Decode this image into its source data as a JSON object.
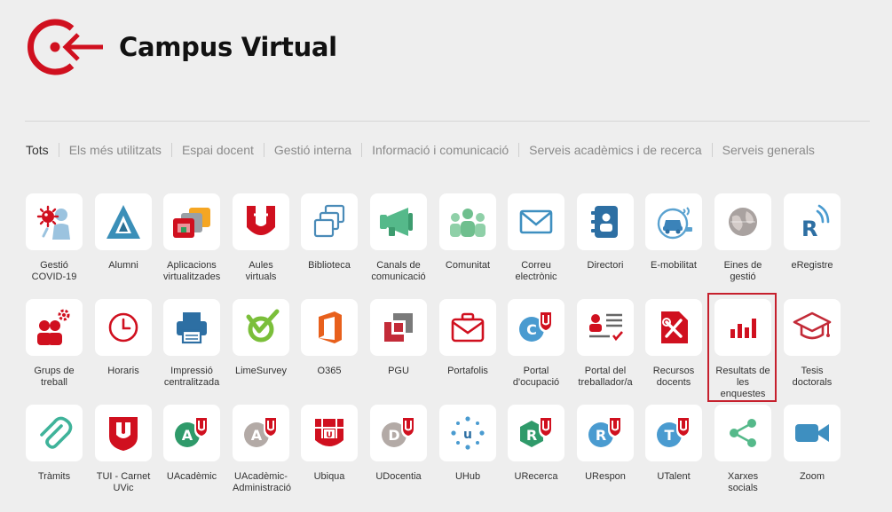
{
  "header": {
    "title": "Campus Virtual",
    "logo_icon": "campus-logo-arrow-icon",
    "brand_color": "#d0101f"
  },
  "filters": [
    {
      "label": "Tots",
      "active": true
    },
    {
      "label": "Els més utilitzats",
      "active": false
    },
    {
      "label": "Espai docent",
      "active": false
    },
    {
      "label": "Gestió interna",
      "active": false
    },
    {
      "label": "Informació i comunicació",
      "active": false
    },
    {
      "label": "Serveis acadèmics i de recerca",
      "active": false
    },
    {
      "label": "Serveis generals",
      "active": false
    }
  ],
  "apps": [
    {
      "id": "gestio-covid-19",
      "label": "Gestió COVID-19",
      "icon": "virus-person-icon"
    },
    {
      "id": "alumni",
      "label": "Alumni",
      "icon": "alumni-a-icon"
    },
    {
      "id": "aplicacions-virtualitzades",
      "label": "Aplicacions virtualitzades",
      "icon": "stacked-folders-icon"
    },
    {
      "id": "aules-virtuals",
      "label": "Aules virtuals",
      "icon": "uvic-u-icon"
    },
    {
      "id": "biblioteca",
      "label": "Biblioteca",
      "icon": "windows-stack-icon"
    },
    {
      "id": "canals-de-comunicacio",
      "label": "Canals de comunicació",
      "icon": "megaphone-icon"
    },
    {
      "id": "comunitat",
      "label": "Comunitat",
      "icon": "people-group-icon"
    },
    {
      "id": "correu-electronic",
      "label": "Correu electrònic",
      "icon": "envelope-icon"
    },
    {
      "id": "directori",
      "label": "Directori",
      "icon": "address-book-icon"
    },
    {
      "id": "e-mobilitat",
      "label": "E-mobilitat",
      "icon": "electric-car-icon"
    },
    {
      "id": "eines-de-gestio",
      "label": "Eines de gestió",
      "icon": "globe-icon"
    },
    {
      "id": "eregistre",
      "label": "eRegistre",
      "icon": "r-signal-icon"
    },
    {
      "id": "grups-de-treball",
      "label": "Grups de treball",
      "icon": "team-gears-icon"
    },
    {
      "id": "horaris",
      "label": "Horaris",
      "icon": "clock-icon"
    },
    {
      "id": "impressio-centralitzada",
      "label": "Impressió centralitzada",
      "icon": "printer-icon"
    },
    {
      "id": "limesurvey",
      "label": "LimeSurvey",
      "icon": "limesurvey-check-icon"
    },
    {
      "id": "o365",
      "label": "O365",
      "icon": "office-icon"
    },
    {
      "id": "pgu",
      "label": "PGU",
      "icon": "pgu-squares-icon"
    },
    {
      "id": "portafolis",
      "label": "Portafolis",
      "icon": "briefcase-icon"
    },
    {
      "id": "portal-docupacio",
      "label": "Portal d'ocupació",
      "icon": "c-uvic-badge-icon"
    },
    {
      "id": "portal-del-treballador",
      "label": "Portal del treballador/a",
      "icon": "id-card-list-icon"
    },
    {
      "id": "recursos-docents",
      "label": "Recursos docents",
      "icon": "tools-document-icon"
    },
    {
      "id": "resultats-de-les-enquestes",
      "label": "Resultats de les enquestes",
      "icon": "bar-chart-icon",
      "highlighted": true
    },
    {
      "id": "tesis-doctorals",
      "label": "Tesis doctorals",
      "icon": "graduation-cap-icon"
    },
    {
      "id": "tramits",
      "label": "Tràmits",
      "icon": "paperclip-icon"
    },
    {
      "id": "tui-carnet-uvic",
      "label": "TUI - Carnet UVic",
      "icon": "uvic-shield-icon"
    },
    {
      "id": "uacademic",
      "label": "UAcadèmic",
      "icon": "a-uvic-badge-icon"
    },
    {
      "id": "uacademic-administracio",
      "label": "UAcadèmic-Administració",
      "icon": "a-uvic-grey-badge-icon"
    },
    {
      "id": "ubiqua",
      "label": "Ubiqua",
      "icon": "ubiqua-icon"
    },
    {
      "id": "udocentia",
      "label": "UDocentia",
      "icon": "d-uvic-badge-icon"
    },
    {
      "id": "uhub",
      "label": "UHub",
      "icon": "uhub-dots-icon"
    },
    {
      "id": "urecerca",
      "label": "URecerca",
      "icon": "r-hexagon-badge-icon"
    },
    {
      "id": "urespon",
      "label": "URespon",
      "icon": "r-uvic-badge-icon"
    },
    {
      "id": "utalent",
      "label": "UTalent",
      "icon": "t-uvic-badge-icon"
    },
    {
      "id": "xarxes-socials",
      "label": "Xarxes socials",
      "icon": "share-icon"
    },
    {
      "id": "zoom",
      "label": "Zoom",
      "icon": "video-camera-icon"
    }
  ]
}
